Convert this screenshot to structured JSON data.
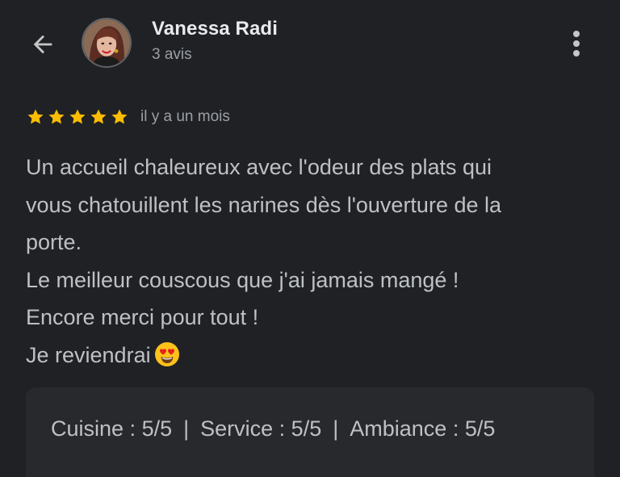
{
  "header": {
    "back_icon": "arrow-back-icon",
    "user_name": "Vanessa Radi",
    "user_meta": "3 avis",
    "more_icon": "more-vertical-icon"
  },
  "review": {
    "rating": 5,
    "rating_max": 5,
    "star_color": "#fbbc04",
    "timestamp": "il y a un mois",
    "lines": [
      "Un accueil chaleureux avec l'odeur des plats qui",
      "vous chatouillent les narines dès l'ouverture de la",
      "porte.",
      "Le meilleur couscous que j'ai jamais mangé !",
      "Encore merci pour tout !",
      "Je reviendrai"
    ],
    "emoji": "heart-eyes-emoji"
  },
  "attributes": [
    {
      "label": "Cuisine",
      "value": "5/5"
    },
    {
      "label": "Service",
      "value": "5/5"
    },
    {
      "label": "Ambiance",
      "value": "5/5"
    }
  ],
  "colors": {
    "background": "#202124",
    "primary_text": "#e8eaed",
    "secondary_text": "#9aa0a6",
    "body_text": "#bdc1c6",
    "card": "#28292c"
  }
}
